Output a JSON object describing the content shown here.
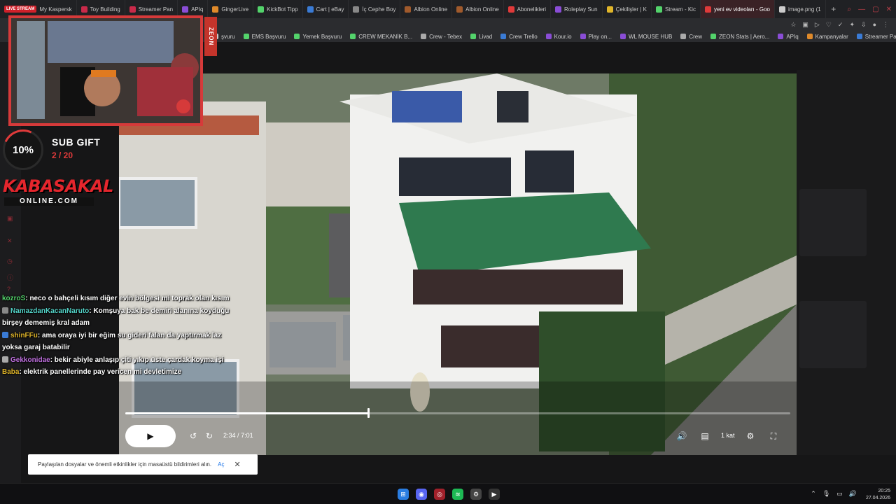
{
  "tabs": [
    {
      "label": "My Kaspersk",
      "badge": "LIVE STREAM",
      "color": "#d0202a"
    },
    {
      "label": "Toy Building",
      "color": "#c92a4a"
    },
    {
      "label": "Streamer Pan",
      "color": "#c92a4a"
    },
    {
      "label": "APIq",
      "color": "#8a4dd6"
    },
    {
      "label": "GingerLive",
      "color": "#e08a2a"
    },
    {
      "label": "KickBot Tipp",
      "color": "#53d36b"
    },
    {
      "label": "Cart | eBay",
      "color": "#3a7bd5"
    },
    {
      "label": "İç Cephe Boy",
      "color": "#888888"
    },
    {
      "label": "Albion Online",
      "color": "#a05a2c"
    },
    {
      "label": "Albion Online",
      "color": "#a05a2c"
    },
    {
      "label": "Abonelikleri",
      "color": "#e03a3a"
    },
    {
      "label": "Roleplay Sun",
      "color": "#8a4dd6"
    },
    {
      "label": "Çekilişler | K",
      "color": "#e0b52a"
    },
    {
      "label": "Stream - Kic",
      "color": "#53d36b"
    },
    {
      "label": "yeni ev videoları - Goo",
      "color": "#e03a3a",
      "active": true
    },
    {
      "label": "image.png (1",
      "color": "#cccccc"
    }
  ],
  "bookmarks": [
    {
      "label": "şvuru",
      "color": "#cccccc"
    },
    {
      "label": "EMS Başvuru",
      "color": "#53d36b"
    },
    {
      "label": "Yemek Başvuru",
      "color": "#53d36b"
    },
    {
      "label": "CREW MEKANİK B...",
      "color": "#53d36b"
    },
    {
      "label": "Crew - Tebex",
      "color": "#aaaaaa"
    },
    {
      "label": "Livad",
      "color": "#53d36b"
    },
    {
      "label": "Crew Trello",
      "color": "#3a7bd5"
    },
    {
      "label": "Kour.io",
      "color": "#8a4dd6"
    },
    {
      "label": "Play on...",
      "color": "#8a4dd6"
    },
    {
      "label": "WL MOUSE HUB",
      "color": "#8a4dd6"
    },
    {
      "label": "Crew",
      "color": "#aaaaaa"
    },
    {
      "label": "ZEON Stats | Aero...",
      "color": "#53d36b"
    },
    {
      "label": "APIq",
      "color": "#8a4dd6"
    },
    {
      "label": "Kampanyalar",
      "color": "#e08a2a"
    },
    {
      "label": "Streamer Panel",
      "color": "#3a7bd5"
    }
  ],
  "overlay": {
    "brand_tag": "ZEON",
    "progress_percent": 10,
    "progress_label": "10%",
    "subgift_label": "SUB GIFT",
    "subgift_count": "2 / 20",
    "logo_main": "KABASAKAL",
    "logo_sub": "ONLINE.COM"
  },
  "chat": [
    {
      "user": "kozroS",
      "user_color": "#53d36b",
      "text": ": neco o bahçeli kısım diğer evin bölgesi mi toprak olan kısım"
    },
    {
      "user": "NamazdanKacanNaruto",
      "user_color": "#53d3c8",
      "text": ": Komşuya bak be demiri alanına koyduğu birşey dememiş kral adam",
      "badge_color": "#888888"
    },
    {
      "user": "shinFFu",
      "user_color": "#e0b52a",
      "text": ": ama oraya iyi bir eğim su gideri falan da yaptırmak laz yoksa garaj batabilir",
      "badge_color": "#3a7bd5"
    },
    {
      "user": "Gekkonidae",
      "user_color": "#c070e0",
      "text": ": bekir abiyle anlaşıp çiti yıkıp üste çardak koyma işi",
      "badge_color": "#aaaaaa"
    },
    {
      "user": "Baba",
      "user_color": "#e0b52a",
      "text": ": elektrik panellerinde pay vericen mi devletimize"
    }
  ],
  "video": {
    "current_time": "2:34",
    "total_time": "7:01",
    "progress_fraction": 0.3655,
    "speed_label": "1 kat"
  },
  "notification": {
    "text": "Paylaşılan dosyalar ve önemli etkinlikler için masaüstü bildirimleri alın.",
    "link": "Aç"
  },
  "clock": {
    "time": "20:25",
    "date": "27.04.2026"
  },
  "colors": {
    "accent_red": "#e03a3a",
    "tab_active_bg": "#3a2226",
    "page_bg": "#161617"
  }
}
